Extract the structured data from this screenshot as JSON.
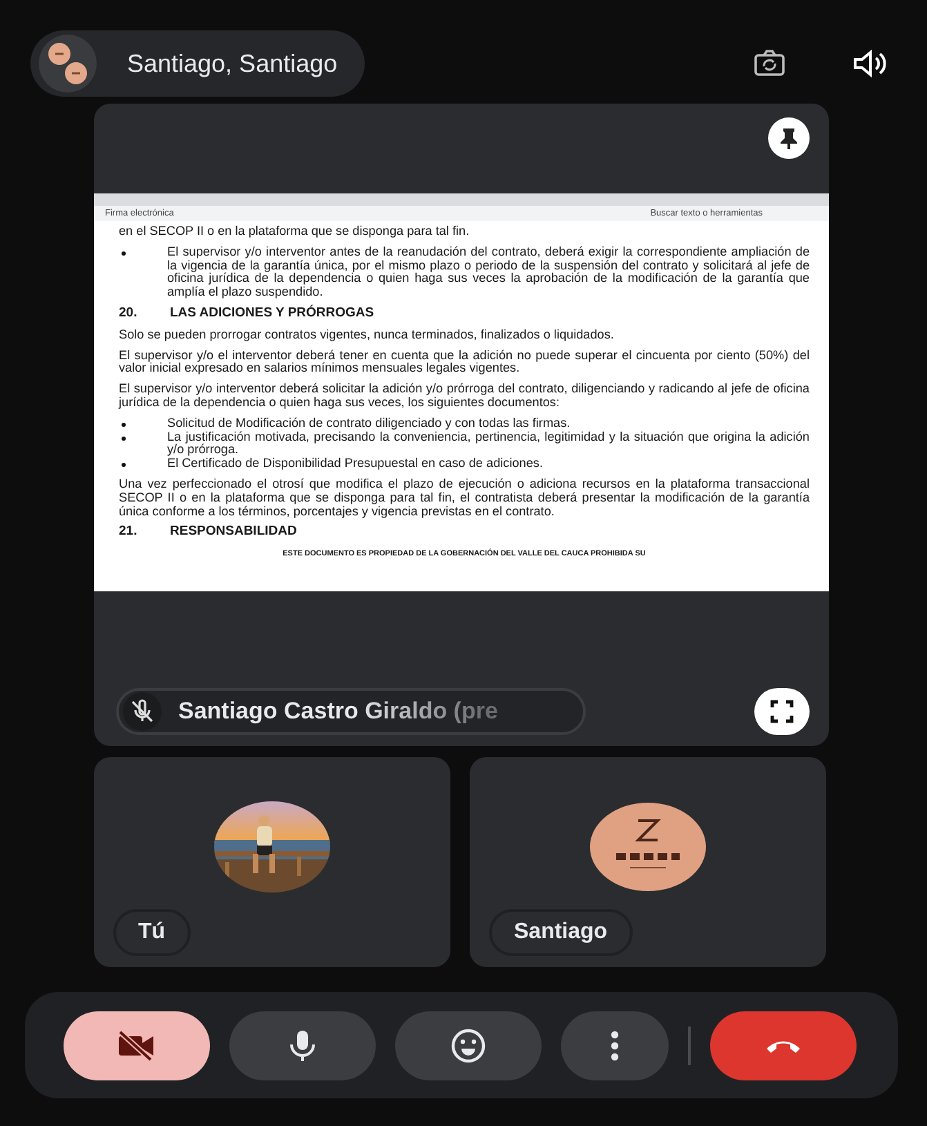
{
  "call": {
    "title": "Santiago, Santiago"
  },
  "presentation": {
    "toolbar_items": [
      "Firma electrónica",
      "Buscar texto o herramientas"
    ],
    "document": [
      {
        "kind": "paragraph",
        "text": "en el SECOP II o en la plataforma que se disponga para tal fin."
      },
      {
        "kind": "bullet",
        "text": "El supervisor y/o interventor antes de la reanudación del contrato, deberá exigir la correspondiente ampliación de la vigencia de la garantía única, por el mismo plazo o periodo de la suspensión del contrato y solicitará al jefe de oficina jurídica de la dependencia o quien haga sus veces la aprobación de la modificación de la garantía que amplía el plazo suspendido."
      },
      {
        "kind": "heading",
        "number": "20.",
        "text": "LAS ADICIONES Y PRÓRROGAS"
      },
      {
        "kind": "paragraph",
        "text": "Solo se pueden prorrogar contratos vigentes, nunca terminados, finalizados o liquidados."
      },
      {
        "kind": "paragraph",
        "text": "El supervisor y/o el interventor deberá tener en cuenta que la adición no puede superar el cincuenta por ciento (50%) del valor inicial expresado en salarios mínimos mensuales legales vigentes."
      },
      {
        "kind": "paragraph",
        "text": "El supervisor y/o interventor deberá solicitar la adición y/o prórroga del contrato, diligenciando y radicando al jefe de oficina jurídica de la dependencia o quien haga sus veces, los siguientes documentos:"
      },
      {
        "kind": "bullet",
        "text": "Solicitud de Modificación de contrato diligenciado y con todas las firmas."
      },
      {
        "kind": "bullet",
        "text": "La justificación motivada, precisando la conveniencia, pertinencia, legitimidad y la situación que origina la adición y/o prórroga."
      },
      {
        "kind": "bullet",
        "text": "El Certificado de Disponibilidad Presupuestal en caso de adiciones."
      },
      {
        "kind": "paragraph",
        "text": "Una vez perfeccionado el otrosí que modifica el plazo de ejecución o adiciona recursos en la plataforma transaccional SECOP II o en la plataforma que se disponga para tal fin, el contratista deberá presentar la modificación de la garantía única conforme a los términos, porcentajes y vigencia previstas en el contrato."
      },
      {
        "kind": "heading",
        "number": "21.",
        "text": "RESPONSABILIDAD"
      },
      {
        "kind": "footer",
        "text": "ESTE DOCUMENTO ES PROPIEDAD DE LA GOBERNACIÓN DEL VALLE DEL CAUCA PROHIBIDA SU"
      }
    ],
    "presenter": {
      "name": "Santiago Castro Giraldo (pre",
      "muted": true
    }
  },
  "tiles": [
    {
      "label": "Tú"
    },
    {
      "label": "Santiago",
      "kind": "logo"
    }
  ],
  "controls": [
    {
      "kind": "camera",
      "on": false
    },
    {
      "kind": "mic",
      "on": true
    },
    {
      "kind": "reactions"
    },
    {
      "kind": "more"
    },
    {
      "kind": "hangup"
    }
  ]
}
